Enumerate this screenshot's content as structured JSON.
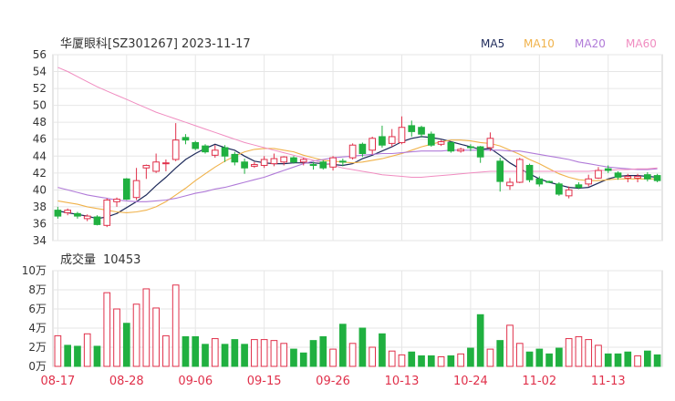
{
  "chart_data": [
    {
      "type": "candlestick",
      "title": "华厦眼科[SZ301267] 2023-11-17",
      "legend": [
        {
          "name": "MA5",
          "color": "#1e2a5a"
        },
        {
          "name": "MA10",
          "color": "#f0b24a"
        },
        {
          "name": "MA20",
          "color": "#b07ad8"
        },
        {
          "name": "MA60",
          "color": "#f08cc0"
        }
      ],
      "ylim": [
        34,
        56
      ],
      "yticks": [
        "56",
        "54",
        "52",
        "50",
        "48",
        "46",
        "44",
        "42",
        "40",
        "38",
        "36",
        "34"
      ],
      "up_color": "#e0304a",
      "down_color": "#20b040",
      "candles": [
        [
          37.6,
          36.9,
          38.0,
          36.6
        ],
        [
          37.3,
          37.6,
          37.8,
          37.0
        ],
        [
          37.2,
          36.9,
          37.4,
          36.6
        ],
        [
          36.6,
          36.9,
          37.1,
          36.3
        ],
        [
          36.8,
          35.9,
          37.0,
          35.8
        ],
        [
          35.8,
          38.8,
          39.0,
          35.6
        ],
        [
          38.6,
          38.9,
          39.1,
          38.0
        ],
        [
          41.3,
          38.9,
          41.4,
          38.8
        ],
        [
          39.1,
          41.1,
          42.6,
          38.8
        ],
        [
          42.6,
          42.9,
          43.0,
          41.3
        ],
        [
          42.2,
          43.3,
          44.3,
          42.0
        ],
        [
          43.1,
          43.2,
          43.6,
          42.2
        ],
        [
          43.6,
          45.9,
          47.9,
          43.4
        ],
        [
          46.2,
          45.9,
          46.6,
          45.4
        ],
        [
          45.6,
          44.9,
          45.8,
          44.7
        ],
        [
          45.2,
          44.5,
          45.4,
          44.3
        ],
        [
          44.1,
          44.7,
          45.3,
          43.8
        ],
        [
          45.0,
          44.0,
          45.3,
          43.3
        ],
        [
          44.2,
          43.3,
          44.5,
          42.9
        ],
        [
          43.3,
          42.6,
          43.7,
          41.9
        ],
        [
          42.8,
          43.0,
          43.3,
          42.6
        ],
        [
          42.9,
          43.6,
          44.0,
          42.6
        ],
        [
          43.1,
          43.7,
          44.3,
          42.8
        ],
        [
          43.3,
          43.9,
          44.0,
          42.9
        ],
        [
          43.8,
          43.3,
          44.0,
          43.1
        ],
        [
          43.3,
          43.6,
          43.8,
          42.9
        ],
        [
          43.0,
          42.9,
          43.3,
          42.4
        ],
        [
          43.3,
          42.6,
          43.5,
          42.4
        ],
        [
          42.7,
          43.8,
          44.0,
          42.3
        ],
        [
          43.4,
          43.3,
          43.7,
          42.8
        ],
        [
          43.8,
          45.3,
          45.5,
          43.6
        ],
        [
          45.4,
          44.3,
          45.6,
          43.9
        ],
        [
          44.7,
          46.1,
          46.3,
          44.2
        ],
        [
          46.3,
          45.3,
          47.6,
          45.0
        ],
        [
          45.5,
          46.3,
          47.2,
          45.1
        ],
        [
          45.6,
          47.4,
          48.7,
          45.4
        ],
        [
          47.6,
          46.9,
          48.2,
          46.3
        ],
        [
          47.4,
          46.6,
          47.6,
          46.2
        ],
        [
          46.6,
          45.3,
          46.9,
          45.1
        ],
        [
          45.4,
          45.7,
          45.9,
          45.2
        ],
        [
          45.6,
          44.6,
          45.7,
          44.4
        ],
        [
          44.6,
          44.8,
          45.0,
          44.4
        ],
        [
          45.1,
          45.0,
          45.4,
          44.6
        ],
        [
          45.1,
          43.9,
          45.2,
          43.2
        ],
        [
          45.0,
          46.1,
          46.8,
          44.6
        ],
        [
          43.4,
          41.0,
          43.8,
          39.8
        ],
        [
          40.5,
          40.9,
          41.4,
          40.0
        ],
        [
          40.9,
          43.6,
          43.8,
          40.8
        ],
        [
          42.9,
          41.2,
          43.1,
          40.9
        ],
        [
          41.3,
          40.7,
          41.6,
          40.4
        ],
        [
          41.0,
          40.9,
          41.1,
          40.8
        ],
        [
          40.7,
          39.5,
          40.9,
          39.3
        ],
        [
          39.3,
          40.0,
          40.4,
          39.0
        ],
        [
          40.6,
          40.3,
          40.9,
          40.1
        ],
        [
          40.7,
          41.3,
          41.8,
          40.4
        ],
        [
          41.4,
          42.3,
          42.7,
          41.3
        ],
        [
          42.5,
          42.3,
          42.9,
          42.0
        ],
        [
          42.0,
          41.5,
          42.2,
          41.2
        ],
        [
          41.4,
          41.6,
          41.9,
          40.9
        ],
        [
          41.4,
          41.6,
          41.9,
          40.9
        ],
        [
          41.8,
          41.3,
          42.1,
          41.0
        ],
        [
          41.7,
          41.1,
          41.9,
          40.9
        ]
      ],
      "ma_series": [
        {
          "name": "MA5",
          "color": "#1e2a5a",
          "width": 1.2,
          "values": [
            37.5,
            37.3,
            37.1,
            36.9,
            36.6,
            36.8,
            37.2,
            37.9,
            38.6,
            39.4,
            40.5,
            41.5,
            42.6,
            43.6,
            44.3,
            44.9,
            45.4,
            45.0,
            44.7,
            44.0,
            43.4,
            43.2,
            43.1,
            43.1,
            43.2,
            43.2,
            43.2,
            43.1,
            43.0,
            42.9,
            43.1,
            43.7,
            44.1,
            44.6,
            45.1,
            45.7,
            46.1,
            46.3,
            46.2,
            46.0,
            45.7,
            45.4,
            45.1,
            44.8,
            44.9,
            44.1,
            43.2,
            42.5,
            41.9,
            41.3,
            40.9,
            40.6,
            40.3,
            40.2,
            40.3,
            40.8,
            41.3,
            41.6,
            41.7,
            41.7,
            41.6,
            41.5
          ]
        },
        {
          "name": "MA10",
          "color": "#f0b24a",
          "width": 1.1,
          "values": [
            38.7,
            38.5,
            38.3,
            38.0,
            37.8,
            37.6,
            37.4,
            37.3,
            37.4,
            37.6,
            38.0,
            38.6,
            39.4,
            40.2,
            41.1,
            41.9,
            42.7,
            43.4,
            44.0,
            44.5,
            44.8,
            44.9,
            44.9,
            44.7,
            44.5,
            44.1,
            43.8,
            43.5,
            43.4,
            43.3,
            43.2,
            43.3,
            43.5,
            43.7,
            44.0,
            44.3,
            44.7,
            45.1,
            45.4,
            45.7,
            45.9,
            45.9,
            45.8,
            45.6,
            45.5,
            45.2,
            44.7,
            44.2,
            43.6,
            43.1,
            42.5,
            41.9,
            41.5,
            41.2,
            41.1,
            41.1,
            41.2,
            41.3,
            41.3,
            41.3,
            41.3,
            41.3
          ]
        },
        {
          "name": "MA20",
          "color": "#b07ad8",
          "width": 1.1,
          "values": [
            40.3,
            40.0,
            39.7,
            39.4,
            39.2,
            39.0,
            38.8,
            38.7,
            38.6,
            38.6,
            38.7,
            38.8,
            39.0,
            39.3,
            39.6,
            39.8,
            40.1,
            40.3,
            40.6,
            40.9,
            41.2,
            41.5,
            41.9,
            42.3,
            42.7,
            43.1,
            43.4,
            43.6,
            43.8,
            43.9,
            44.0,
            44.1,
            44.2,
            44.3,
            44.3,
            44.4,
            44.5,
            44.6,
            44.6,
            44.6,
            44.7,
            44.7,
            44.7,
            44.7,
            44.7,
            44.7,
            44.6,
            44.6,
            44.4,
            44.2,
            44.0,
            43.8,
            43.6,
            43.3,
            43.1,
            42.9,
            42.7,
            42.6,
            42.5,
            42.4,
            42.4,
            42.5
          ]
        },
        {
          "name": "MA60",
          "color": "#f08cc0",
          "width": 1.0,
          "values": [
            54.5,
            54.0,
            53.4,
            52.8,
            52.2,
            51.7,
            51.2,
            50.7,
            50.2,
            49.7,
            49.2,
            48.8,
            48.4,
            48.0,
            47.6,
            47.2,
            46.8,
            46.4,
            46.0,
            45.6,
            45.3,
            45.0,
            44.7,
            44.4,
            44.1,
            43.8,
            43.5,
            43.2,
            42.9,
            42.6,
            42.4,
            42.2,
            42.0,
            41.8,
            41.7,
            41.6,
            41.5,
            41.5,
            41.6,
            41.7,
            41.8,
            41.9,
            42.0,
            42.1,
            42.2,
            42.2,
            42.2,
            42.2,
            42.2,
            42.2,
            42.2,
            42.2,
            42.2,
            42.2,
            42.2,
            42.3,
            42.3,
            42.4,
            42.4,
            42.5,
            42.5,
            42.6
          ]
        }
      ],
      "x_ticks": [
        {
          "label": "08-17",
          "index": 0
        },
        {
          "label": "08-28",
          "index": 7
        },
        {
          "label": "09-06",
          "index": 14
        },
        {
          "label": "09-15",
          "index": 21
        },
        {
          "label": "09-26",
          "index": 28
        },
        {
          "label": "10-13",
          "index": 35
        },
        {
          "label": "10-24",
          "index": 42
        },
        {
          "label": "11-02",
          "index": 49
        },
        {
          "label": "11-13",
          "index": 56
        }
      ]
    },
    {
      "type": "bar",
      "title": "成交量",
      "latest_value": "10453",
      "ylim": [
        0,
        100000
      ],
      "yticks": [
        "10万",
        "8万",
        "6万",
        "4万",
        "2万",
        "0万"
      ],
      "values": [
        32000,
        22000,
        21000,
        34000,
        21000,
        77000,
        60000,
        45000,
        65000,
        81000,
        61000,
        32000,
        85000,
        31000,
        31000,
        23000,
        29000,
        23000,
        28000,
        23000,
        28000,
        28000,
        27000,
        24000,
        18000,
        14000,
        27000,
        31000,
        18000,
        44000,
        24000,
        40000,
        20000,
        34000,
        16000,
        12000,
        15000,
        11000,
        11000,
        10000,
        11000,
        13000,
        19000,
        54000,
        18000,
        27000,
        43000,
        24000,
        15000,
        18000,
        13000,
        19000,
        29000,
        31000,
        28000,
        22000,
        13000,
        13000,
        15000,
        11000,
        16000,
        12000
      ],
      "up": [
        true,
        false,
        false,
        true,
        false,
        true,
        true,
        false,
        true,
        true,
        true,
        true,
        true,
        false,
        false,
        false,
        true,
        false,
        false,
        false,
        true,
        true,
        true,
        true,
        false,
        false,
        false,
        false,
        true,
        false,
        true,
        false,
        true,
        false,
        true,
        true,
        false,
        false,
        false,
        true,
        false,
        true,
        false,
        false,
        true,
        false,
        true,
        true,
        false,
        false,
        false,
        false,
        true,
        true,
        true,
        true,
        false,
        false,
        false,
        true,
        false,
        false
      ]
    }
  ]
}
